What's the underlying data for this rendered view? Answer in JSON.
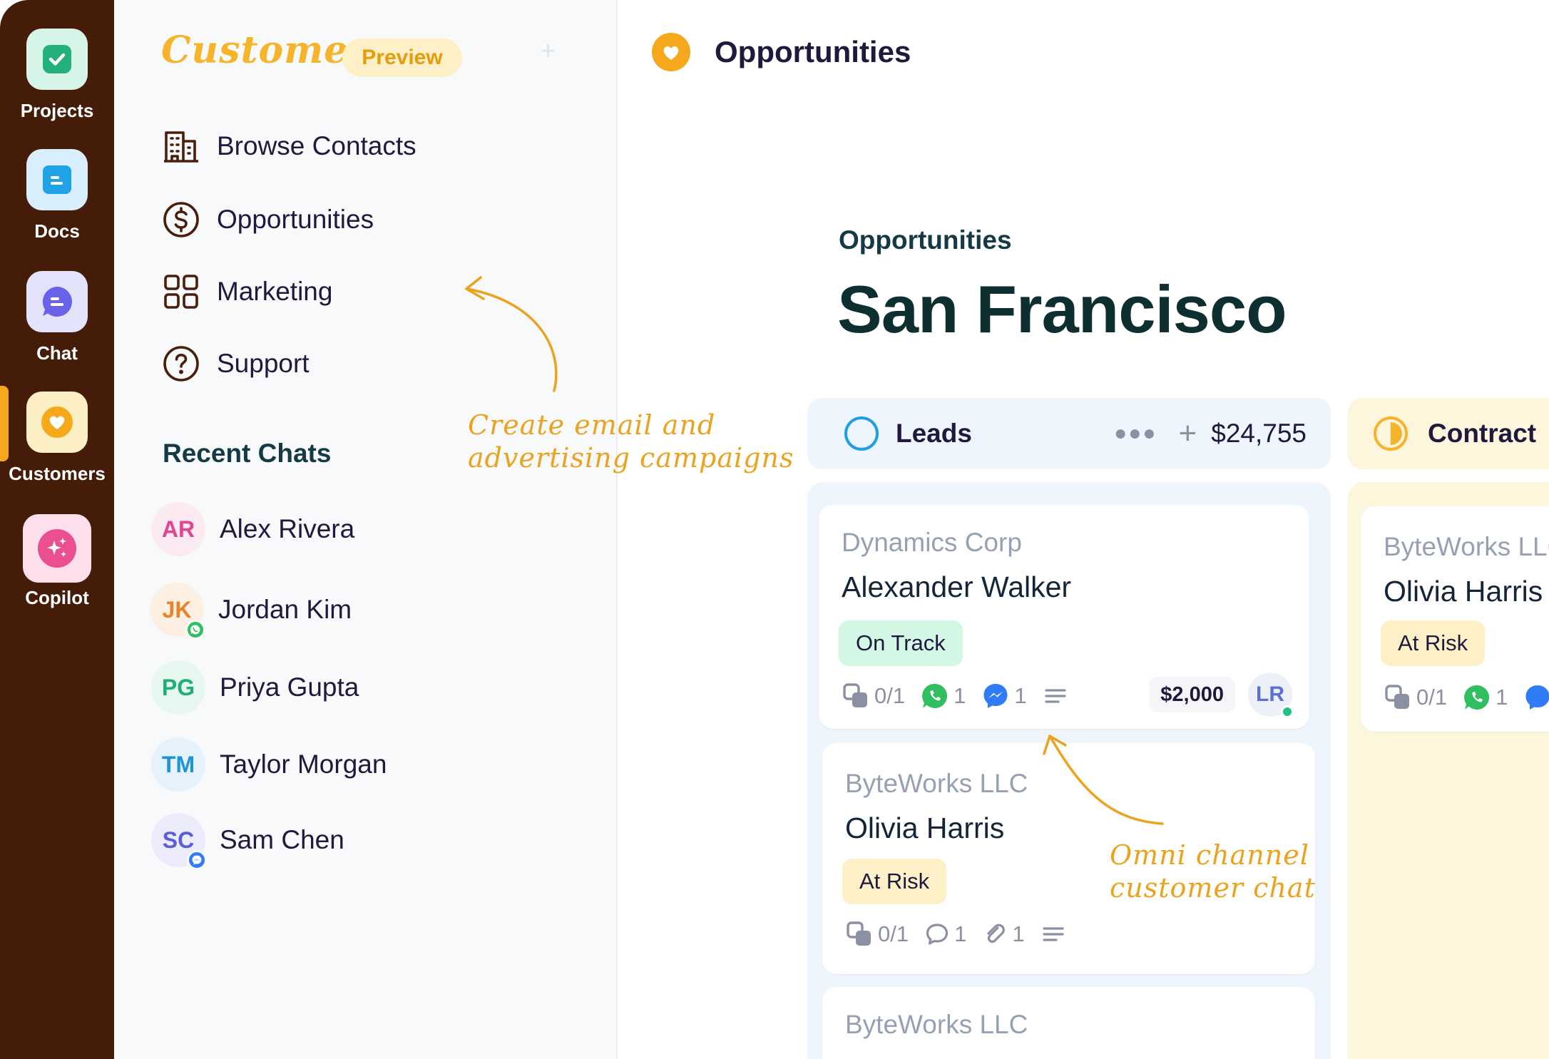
{
  "rail": {
    "items": [
      {
        "label": "Projects",
        "icon": "check-square-icon",
        "tile_color": "#d6f5e8",
        "icon_color": "#22b07d"
      },
      {
        "label": "Docs",
        "icon": "document-icon",
        "tile_color": "#d9eefc",
        "icon_color": "#1fa2e6"
      },
      {
        "label": "Chat",
        "icon": "chat-bubble-icon",
        "tile_color": "#e3e3fb",
        "icon_color": "#6a63e9"
      },
      {
        "label": "Customers",
        "icon": "heart-icon",
        "tile_color": "#fdefc4",
        "icon_color": "#f5a81c"
      },
      {
        "label": "Copilot",
        "icon": "sparkles-icon",
        "tile_color": "#fde0ec",
        "icon_color": "#ec4f8f"
      }
    ],
    "active": "Customers"
  },
  "panel": {
    "brand": "Customers",
    "badge": "Preview",
    "nav": [
      {
        "label": "Browse Contacts",
        "icon": "building-icon"
      },
      {
        "label": "Opportunities",
        "icon": "dollar-circle-icon"
      },
      {
        "label": "Marketing",
        "icon": "grid-icon"
      },
      {
        "label": "Support",
        "icon": "help-circle-icon"
      }
    ],
    "recent_title": "Recent Chats",
    "chats": [
      {
        "initials": "AR",
        "name": "Alex Rivera",
        "color": "#e0468f",
        "bg": "#fbeaf2",
        "channel": ""
      },
      {
        "initials": "JK",
        "name": "Jordan Kim",
        "color": "#e9822a",
        "bg": "#fdf0e2",
        "channel": "whatsapp"
      },
      {
        "initials": "PG",
        "name": "Priya Gupta",
        "color": "#1fae7a",
        "bg": "#e6f7ef",
        "channel": ""
      },
      {
        "initials": "TM",
        "name": "Taylor Morgan",
        "color": "#1f93d8",
        "bg": "#e5f2fb",
        "channel": ""
      },
      {
        "initials": "SC",
        "name": "Sam Chen",
        "color": "#5a5ed8",
        "bg": "#ebebfb",
        "channel": "messenger"
      }
    ]
  },
  "annotations": {
    "marketing": [
      "Create email and",
      "advertising campaigns"
    ],
    "chat": [
      "Omni channel",
      "customer chat"
    ]
  },
  "header": {
    "title": "Opportunities"
  },
  "page": {
    "kicker": "Opportunities",
    "title": "San Francisco"
  },
  "columns": [
    {
      "name": "Leads",
      "total": "$24,755",
      "status_icon": "empty-circle-icon"
    },
    {
      "name": "Contract",
      "status_icon": "half-circle-icon"
    }
  ],
  "cards": [
    {
      "company": "Dynamics Corp",
      "contact": "Alexander Walker",
      "status": "On Track",
      "tasks": "0/1",
      "whatsapp": "1",
      "messenger": "1",
      "amount": "$2,000",
      "owner": "LR"
    },
    {
      "company": "ByteWorks LLC",
      "contact": "Olivia Harris",
      "status": "At Risk",
      "tasks": "0/1",
      "comments": "1",
      "attachments": "1"
    },
    {
      "company": "ByteWorks LLC"
    },
    {
      "company": "ByteWorks LLC",
      "contact": "Olivia Harris",
      "status": "At Risk",
      "tasks": "0/1",
      "whatsapp": "1"
    }
  ],
  "colors": {
    "rail": "#441c07",
    "accent": "#f5a81c",
    "on_track": "#d4f6e5",
    "at_risk": "#fdf0c7"
  }
}
